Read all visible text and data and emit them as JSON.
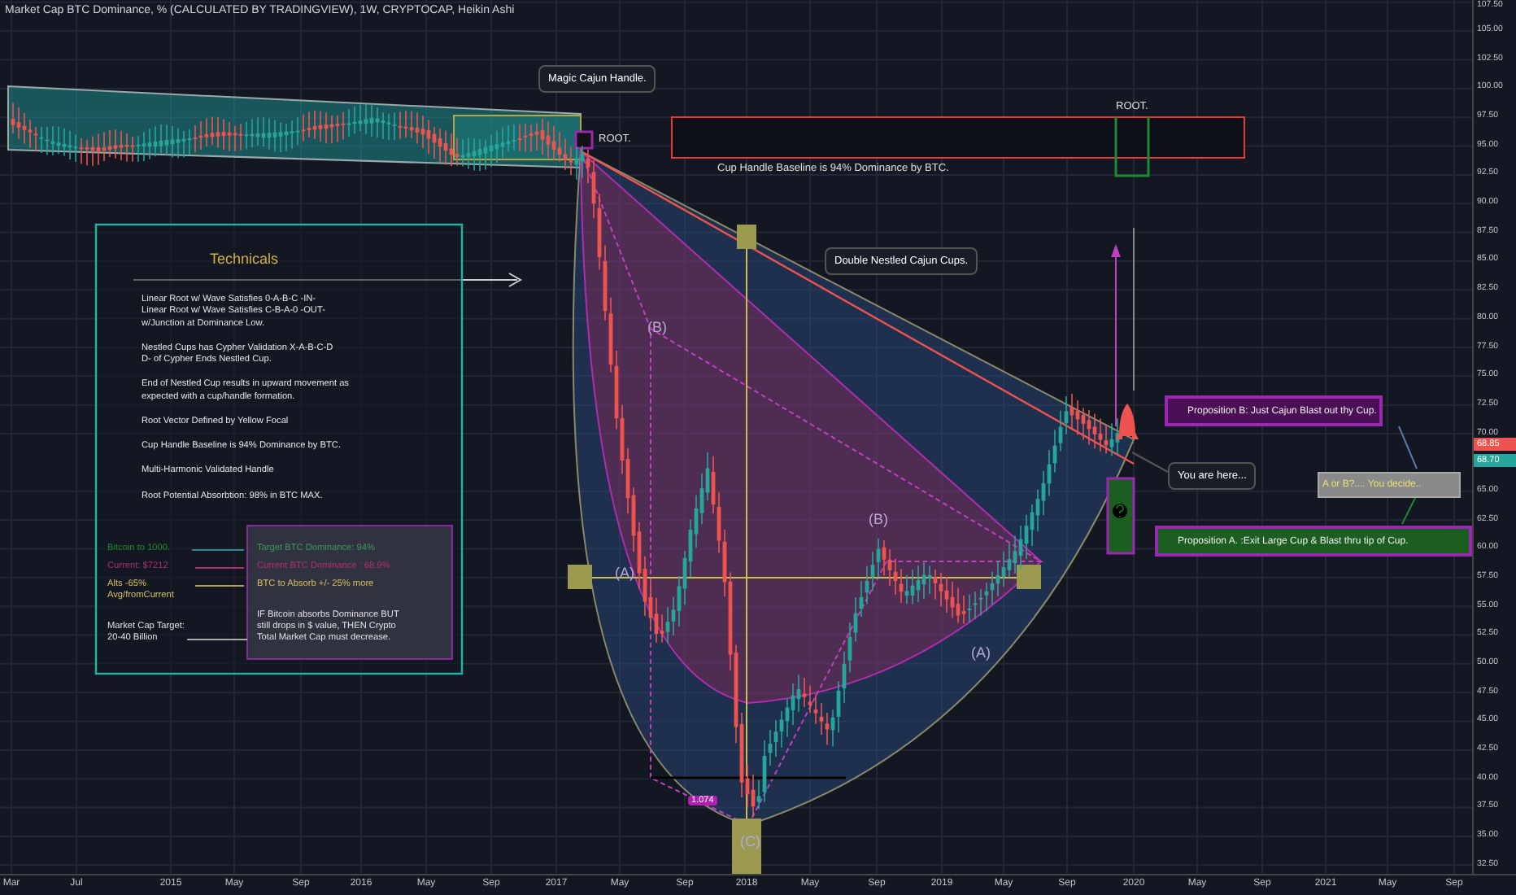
{
  "chart_title": "Market Cap BTC Dominance, % (CALCULATED BY TRADINGVIEW), 1W, CRYPTOCAP, Heikin Ashi",
  "price_axis": {
    "ticks": [
      "107.50",
      "105.00",
      "102.50",
      "100.00",
      "97.50",
      "95.00",
      "92.50",
      "90.00",
      "87.50",
      "85.00",
      "82.50",
      "80.00",
      "77.50",
      "75.00",
      "72.50",
      "70.00",
      "65.00",
      "62.50",
      "60.00",
      "57.50",
      "55.00",
      "52.50",
      "50.00",
      "47.50",
      "45.00",
      "42.50",
      "40.00",
      "37.50",
      "35.00",
      "32.50"
    ],
    "price_tags": [
      {
        "value": "68.85",
        "color": "#ef5350"
      },
      {
        "value": "68.70",
        "color": "#26a69a"
      }
    ]
  },
  "time_axis": {
    "ticks": [
      "Mar",
      "Jul",
      "2015",
      "May",
      "Sep",
      "2016",
      "May",
      "Sep",
      "2017",
      "May",
      "Sep",
      "2018",
      "May",
      "Sep",
      "2019",
      "May",
      "Sep",
      "2020",
      "May",
      "Sep",
      "2021",
      "May",
      "Sep"
    ]
  },
  "callouts": [
    "Magic Cajun Handle.",
    "Double Nestled Cajun Cups.",
    "You are here..."
  ],
  "chart_notes": [
    "ROOT.",
    "ROOT.",
    "Cup Handle Baseline is 94% Dominance by BTC."
  ],
  "pattern_labels": [
    "(B)",
    "(A)",
    "(B)",
    "(A)",
    "(C)",
    "1.074"
  ],
  "technicals": {
    "title": "Technicals",
    "notes": [
      "Linear Root w/ Wave Satisfies 0-A-B-C -IN-\nLinear Root w/ Wave Satisfies C-B-A-0 -OUT-\nw/Junction at Dominance Low.",
      "Nestled Cups has Cypher Validation X-A-B-C-D\nD- of Cypher Ends Nestled Cup.",
      "End of Nestled Cup results in upward movement as\nexpected with a cup/handle formation.",
      "Root Vector Defined by Yellow Focal",
      "Cup Handle Baseline is 94% Dominance by BTC.",
      "Multi-Harmonic Validated Handle",
      "Root Potential Absorbtion: 98% in BTC MAX."
    ]
  },
  "targets": [
    {
      "text": "Bitcoin to 1000.",
      "color": "#1e8a30"
    },
    {
      "text": "Current: $7212",
      "color": "#b0306a"
    },
    {
      "text": "Alts -65%\nAvg/fromCurrent",
      "color": "#d4c060"
    },
    {
      "text": "Market Cap Target:\n20-40 Billion",
      "color": "#e0e0e0"
    }
  ],
  "dominance_box": [
    {
      "text": "Target BTC Dominance: 94%",
      "color": "#3a9a5a"
    },
    {
      "text": "Current BTC Dominance : 68.9%",
      "color": "#b0306a"
    },
    {
      "text": "BTC to Absorb +/- 25% more",
      "color": "#d4c060"
    },
    {
      "text": "IF Bitcoin absorbs Dominance BUT\nstill drops in $ value, THEN Crypto\nTotal Market Cap must decrease.",
      "color": "#e0e0e0"
    }
  ],
  "propositions": [
    {
      "text": "Proposition B: Just Cajun Blast out thy Cup.",
      "color": "#4a0f55"
    },
    {
      "text": "A or B?.... You decide..",
      "color": "#8a8a8a"
    },
    {
      "text": "Proposition A. :Exit Large Cup & Blast thru tip of Cup.",
      "color": "#1b5e20"
    }
  ]
}
